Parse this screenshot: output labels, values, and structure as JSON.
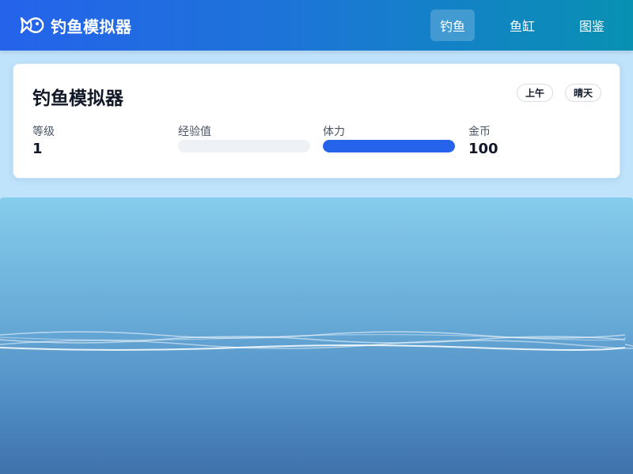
{
  "app": {
    "title": "钓鱼模拟器",
    "icon": "fish-icon"
  },
  "nav": {
    "items": [
      {
        "label": "钓鱼",
        "active": true
      },
      {
        "label": "鱼缸",
        "active": false
      },
      {
        "label": "图鉴",
        "active": false
      }
    ]
  },
  "status": {
    "title": "钓鱼模拟器",
    "time_of_day": "上午",
    "weather": "晴天",
    "level_label": "等级",
    "level_value": "1",
    "exp_label": "经验值",
    "exp_fraction": 0,
    "stamina_label": "体力",
    "stamina_fraction": 1,
    "coins_label": "金币",
    "coins_value": "100"
  },
  "colors": {
    "nav_gradient_start": "#2563eb",
    "nav_gradient_end": "#0891b2",
    "stamina_bar": "#2563eb",
    "water_top": "#86ccec",
    "water_bottom": "#3f71ab"
  }
}
